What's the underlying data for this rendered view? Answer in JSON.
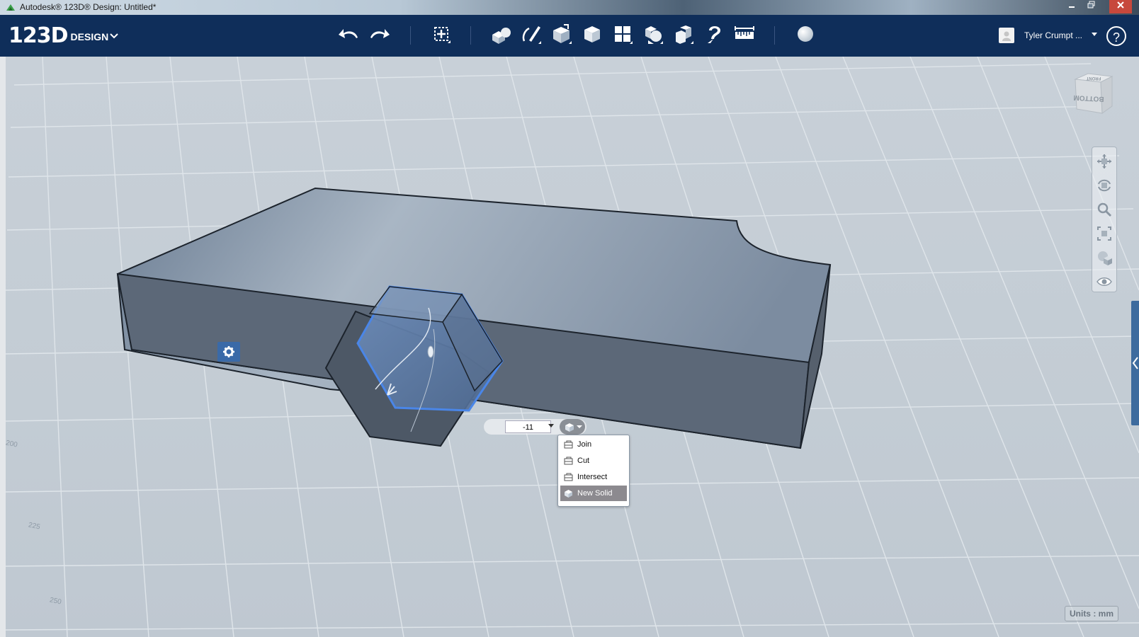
{
  "window": {
    "title": "Autodesk® 123D® Design: Untitled*",
    "buttons": [
      "minimize",
      "restore",
      "close"
    ]
  },
  "app": {
    "logo_number": "123D",
    "logo_word": "DESIGN"
  },
  "toolbar": {
    "tools": [
      "undo",
      "redo",
      "transform",
      "primitives",
      "sketch",
      "construct",
      "modify",
      "pattern",
      "grouping",
      "combine",
      "snap",
      "measure",
      "material"
    ]
  },
  "user": {
    "name": "Tyler Crumpt ..."
  },
  "canvas": {
    "distance_value": "-11",
    "boolean_menu": {
      "items": [
        "Join",
        "Cut",
        "Intersect",
        "New Solid"
      ],
      "selected": "New Solid"
    },
    "units_label": "Units : mm",
    "grid_labels": [
      "200",
      "225",
      "250"
    ],
    "viewcube_labels": [
      "FRONT",
      "BOTTOM"
    ]
  },
  "colors": {
    "toolbar_bg": "#0f2e5a",
    "viewport_bg": "#c3ccd4",
    "solid_top": "#7f8fa2",
    "solid_side": "#596675",
    "selection": "#3f7be0"
  }
}
